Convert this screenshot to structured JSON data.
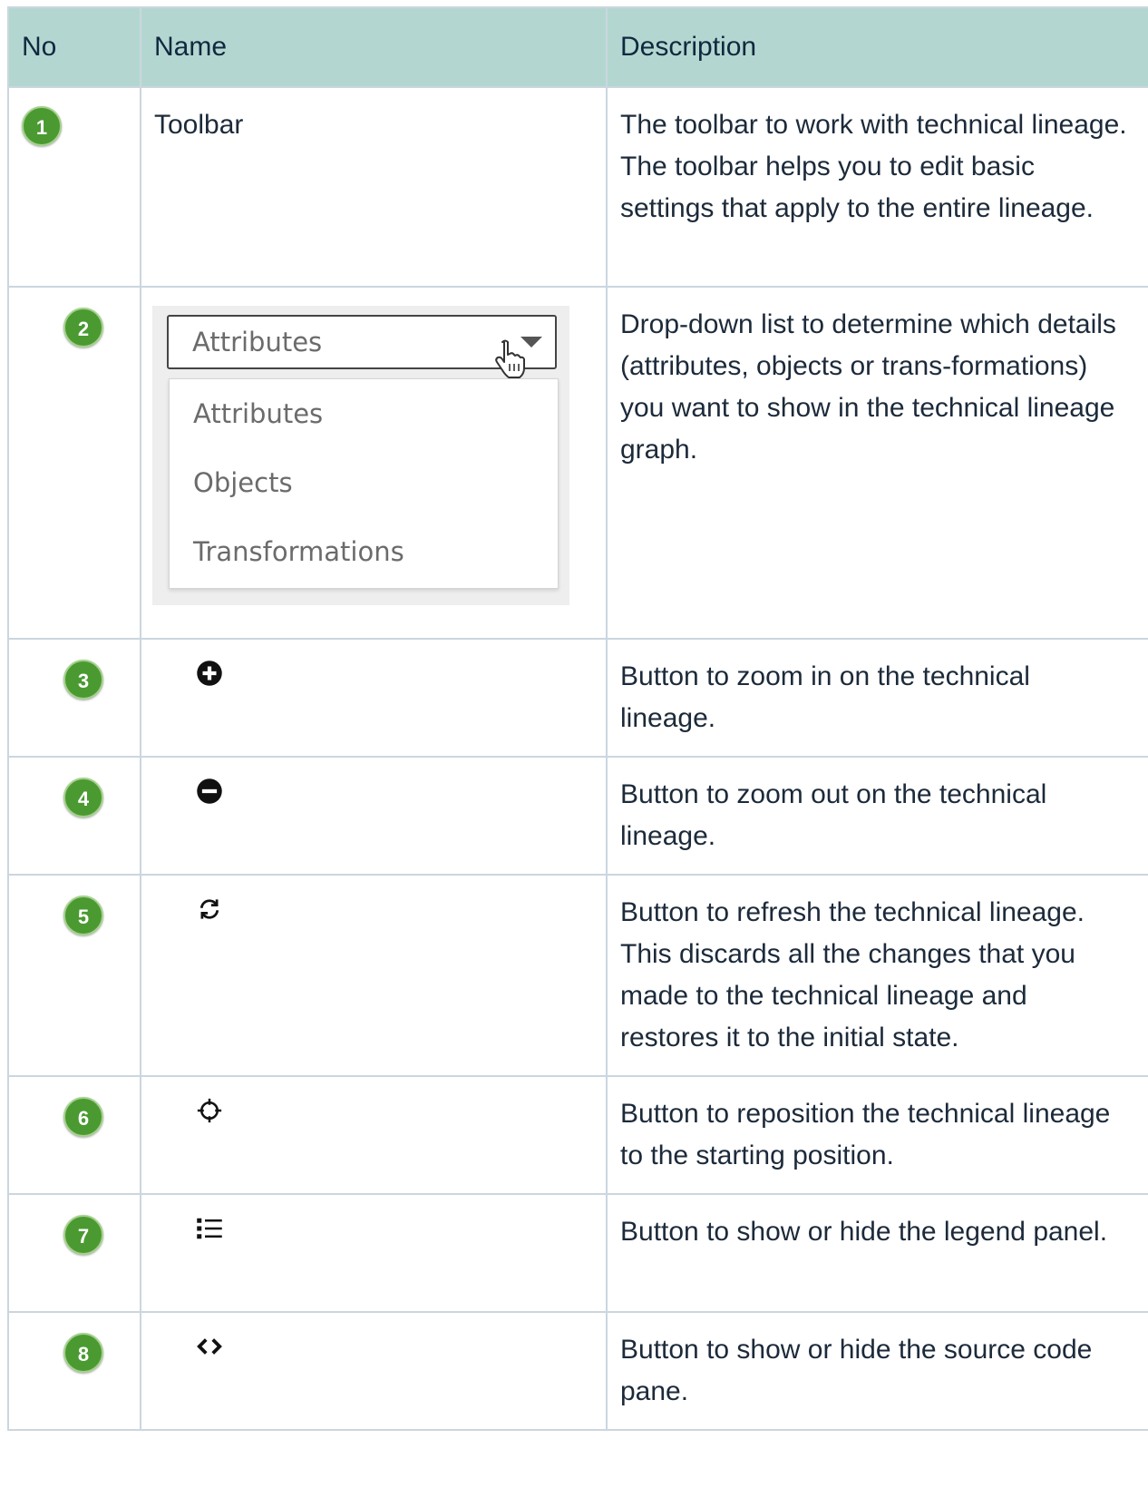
{
  "header": {
    "no": "No",
    "name": "Name",
    "description": "Description"
  },
  "rows": [
    {
      "no": "1",
      "name": "Toolbar",
      "icon": null,
      "description": "The toolbar to work with technical lineage. The toolbar helps you to edit basic settings that apply to the entire lineage."
    },
    {
      "no": "2",
      "name": "",
      "icon": "dropdown-screenshot",
      "description": "Drop-down list to determine which details (attributes, objects or trans-formations) you want to show in the technical lineage graph."
    },
    {
      "no": "3",
      "name": "",
      "icon": "zoom-in-icon",
      "description": "Button to zoom in on the technical lineage."
    },
    {
      "no": "4",
      "name": "",
      "icon": "zoom-out-icon",
      "description": "Button to zoom out on the technical lineage."
    },
    {
      "no": "5",
      "name": "",
      "icon": "refresh-icon",
      "description": "Button to refresh the technical lineage. This discards all the changes that you made to the technical lineage and restores it to the initial state."
    },
    {
      "no": "6",
      "name": "",
      "icon": "crosshair-icon",
      "description": "Button to reposition the technical lineage to the starting position."
    },
    {
      "no": "7",
      "name": "",
      "icon": "list-icon",
      "description": "Button to show or hide the legend panel."
    },
    {
      "no": "8",
      "name": "",
      "icon": "code-icon",
      "description": "Button to show or hide the source code pane."
    }
  ],
  "dropdown": {
    "selected": "Attributes",
    "options": [
      "Attributes",
      "Objects",
      "Transformations"
    ]
  },
  "colors": {
    "header_bg": "#b3d7d0",
    "step_badge": "#4a9a31",
    "border": "#cbd6df"
  }
}
